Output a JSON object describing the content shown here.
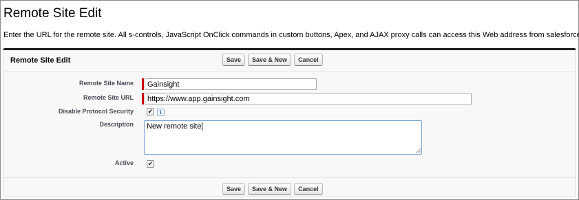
{
  "page": {
    "title": "Remote Site Edit",
    "intro": "Enter the URL for the remote site. All s-controls, JavaScript OnClick commands in custom buttons, Apex, and AJAX proxy calls can access this Web address from salesforce.com."
  },
  "panel": {
    "title": "Remote Site Edit",
    "buttons": {
      "save": "Save",
      "save_new": "Save & New",
      "cancel": "Cancel"
    }
  },
  "form": {
    "site_name": {
      "label": "Remote Site Name",
      "value": "Gainsight"
    },
    "site_url": {
      "label": "Remote Site URL",
      "value": "https://www.app.gainsight.com"
    },
    "disable_protocol_security": {
      "label": "Disable Protocol Security",
      "checked": true,
      "info_icon": "i"
    },
    "description": {
      "label": "Description",
      "value": "New remote site"
    },
    "active": {
      "label": "Active",
      "checked": true
    }
  },
  "colors": {
    "required_bar": "#cc0000",
    "panel_border_top": "#1f1f1f"
  },
  "icons": {
    "checkbox_check": "✔",
    "info": "info-icon"
  }
}
